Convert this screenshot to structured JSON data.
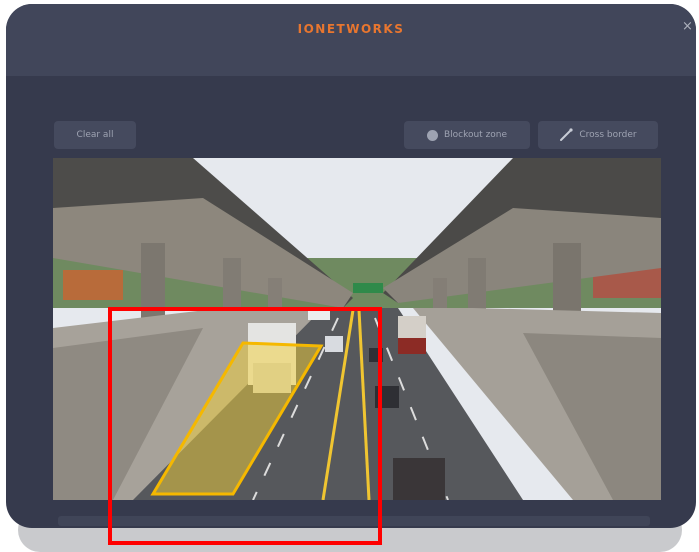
{
  "header": {
    "brand": "IONETWORKS",
    "close_symbol": "×"
  },
  "toolbar": {
    "clear_all_label": "Clear all",
    "blockout_zone_label": "Blockout zone",
    "cross_border_label": "Cross border"
  },
  "colors": {
    "modal_bg": "#363a4d",
    "header_bg": "#41465a",
    "brand": "#e8762f",
    "zone_fill": "#f2cf3a",
    "zone_stroke": "#f5b800",
    "highlight": "#ff0000"
  },
  "icons": {
    "blockout": "circle-icon",
    "cross_border": "diagonal-line-icon",
    "close": "close-icon"
  }
}
